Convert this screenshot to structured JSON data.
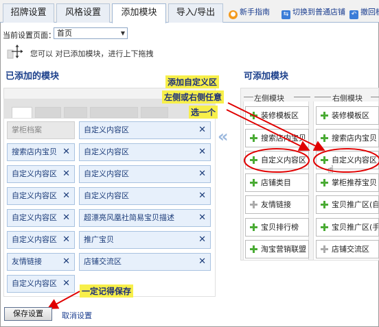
{
  "tabs": [
    {
      "label": "招牌设置",
      "active": false
    },
    {
      "label": "风格设置",
      "active": false
    },
    {
      "label": "添加模块",
      "active": true
    },
    {
      "label": "导入/导出",
      "active": false
    }
  ],
  "top_links": {
    "guide": "新手指南",
    "switch": "切换到普通店铺",
    "undo": "撤回模"
  },
  "page_selector": {
    "label": "当前设置页面：",
    "value": "首页"
  },
  "hint_text": "您可以 对已添加模块，进行上下拖拽",
  "added_title": "已添加的模块",
  "available_title": "可添加模块",
  "left_column": [
    {
      "label": "掌柜档案",
      "disabled": true
    },
    {
      "label": "搜索店内宝贝",
      "disabled": false
    },
    {
      "label": "自定义内容区",
      "disabled": false
    },
    {
      "label": "自定义内容区",
      "disabled": false
    },
    {
      "label": "自定义内容区",
      "disabled": false
    },
    {
      "label": "自定义内容区",
      "disabled": false
    },
    {
      "label": "友情链接",
      "disabled": false
    },
    {
      "label": "自定义内容区",
      "disabled": false
    }
  ],
  "middle_column": [
    {
      "label": "自定义内容区"
    },
    {
      "label": "自定义内容区"
    },
    {
      "label": "自定义内容区"
    },
    {
      "label": "自定义内容区"
    },
    {
      "label": "超漂亮风凰社简易宝贝描述"
    },
    {
      "label": "推广宝贝"
    },
    {
      "label": "店铺交流区"
    }
  ],
  "remove_icon": "✕",
  "right_panel": {
    "left_header": "左侧模块",
    "right_header": "右侧模块",
    "left_items": [
      {
        "label": "装修模板区",
        "grey": false
      },
      {
        "label": "搜索店内宝贝",
        "grey": false
      },
      {
        "label": "自定义内容区",
        "grey": false
      },
      {
        "label": "店铺类目",
        "grey": false
      },
      {
        "label": "友情链接",
        "grey": true
      },
      {
        "label": "宝贝排行榜",
        "grey": false
      },
      {
        "label": "淘宝营销联盟",
        "grey": false
      }
    ],
    "right_items": [
      {
        "label": "装修模板区",
        "grey": false
      },
      {
        "label": "搜索店内宝贝",
        "grey": false
      },
      {
        "label": "自定义内容区",
        "grey": false
      },
      {
        "label": "掌柜推荐宝贝",
        "grey": false
      },
      {
        "label": "宝贝推广区(自",
        "grey": false
      },
      {
        "label": "宝贝推广区(手",
        "grey": false
      },
      {
        "label": "店铺交流区",
        "grey": true
      }
    ]
  },
  "annotation_top": [
    "添加自定义区",
    "左侧或右侧任意",
    "选一个"
  ],
  "annotation_bottom": "一定记得保存",
  "save_button": "保存设置",
  "cancel_link": "取消设置",
  "colors": {
    "accent_blue": "#1b3f8b",
    "module_bg": "#e7f0fb",
    "callout_yellow": "#f7ef4a",
    "arrow_red": "#e00000",
    "plus_green": "#4aab34"
  }
}
